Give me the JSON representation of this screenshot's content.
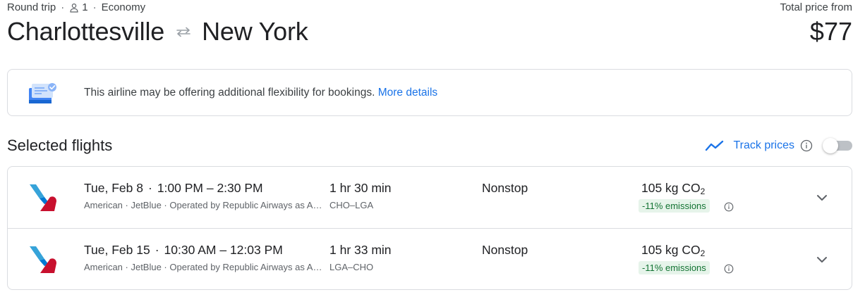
{
  "header": {
    "trip_type": "Round trip",
    "passengers": "1",
    "cabin": "Economy",
    "origin": "Charlottesville",
    "destination": "New York",
    "price_label": "Total price from",
    "price": "$77"
  },
  "notice": {
    "message": "This airline may be offering additional flexibility for bookings.",
    "link": "More details"
  },
  "selected": {
    "title": "Selected flights",
    "track_label": "Track prices",
    "track_enabled": false
  },
  "flights": [
    {
      "date": "Tue, Feb 8",
      "times": "1:00 PM – 2:30 PM",
      "airlines": "American · JetBlue · Operated by Republic Airways as American Eagle",
      "duration": "1 hr 30 min",
      "route": "CHO–LGA",
      "stops": "Nonstop",
      "co2_value": "105 kg CO",
      "co2_sub": "2",
      "emissions": "-11% emissions"
    },
    {
      "date": "Tue, Feb 15",
      "times": "10:30 AM – 12:03 PM",
      "airlines": "American · JetBlue · Operated by Republic Airways as American Eagle",
      "duration": "1 hr 33 min",
      "route": "LGA–CHO",
      "stops": "Nonstop",
      "co2_value": "105 kg CO",
      "co2_sub": "2",
      "emissions": "-11% emissions"
    }
  ],
  "colors": {
    "link": "#1a73e8",
    "emissions_text": "#137333",
    "emissions_bg": "#e6f4ea",
    "border": "#dadce0",
    "airline_red": "#c8102e",
    "airline_blue": "#36a3d9"
  },
  "icons": {
    "passenger": "person-icon",
    "swap": "swap-arrows-icon",
    "notice": "ticket-calendar-icon",
    "trend": "trend-line-icon",
    "info": "info-icon",
    "airline": "american-airlines-logo",
    "expand": "chevron-down-icon"
  }
}
